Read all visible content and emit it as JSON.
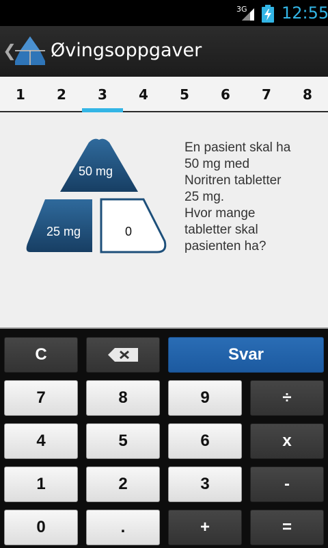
{
  "status_bar": {
    "network": "3G",
    "time": "12:55"
  },
  "action_bar": {
    "title": "Øvingsoppgaver"
  },
  "tabs": [
    {
      "label": "1",
      "active": false
    },
    {
      "label": "2",
      "active": false
    },
    {
      "label": "3",
      "active": true
    },
    {
      "label": "4",
      "active": false
    },
    {
      "label": "5",
      "active": false
    },
    {
      "label": "6",
      "active": false
    },
    {
      "label": "7",
      "active": false
    },
    {
      "label": "8",
      "active": false
    }
  ],
  "exercise": {
    "top_value": "50 mg",
    "left_value": "25 mg",
    "answer_value": "0",
    "question_lines": [
      "En pasient skal ha",
      "50 mg med",
      "Noritren tabletter",
      "25 mg.",
      "Hvor mange",
      "tabletter skal",
      "pasienten ha?"
    ]
  },
  "keypad": {
    "clear": "C",
    "answer": "Svar",
    "seven": "7",
    "eight": "8",
    "nine": "9",
    "divide": "÷",
    "four": "4",
    "five": "5",
    "six": "6",
    "multiply": "x",
    "one": "1",
    "two": "2",
    "three": "3",
    "minus": "-",
    "zero": "0",
    "decimal": ".",
    "plus": "+",
    "equals": "="
  },
  "colors": {
    "accent": "#33b5e5",
    "pyramid": "#1d4f7a",
    "answer_button": "#2266b0"
  }
}
